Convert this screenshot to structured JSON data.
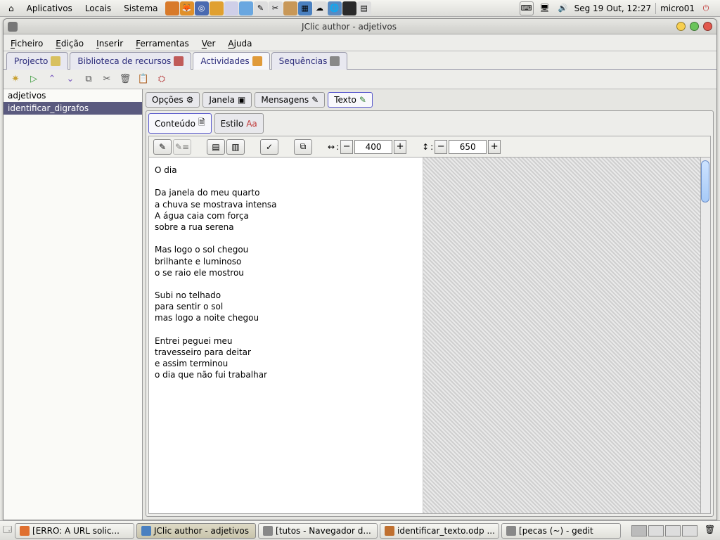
{
  "top_panel": {
    "home": "⌂",
    "menus": {
      "apps": "Aplicativos",
      "places": "Locais",
      "system": "Sistema"
    },
    "clock": "Seg 19 Out, 12:27",
    "user": "micro01"
  },
  "window": {
    "title": "JClic author - adjetivos",
    "menus": {
      "file": "Ficheiro",
      "edit": "Edição",
      "insert": "Inserir",
      "tools": "Ferramentas",
      "view": "Ver",
      "help": "Ajuda"
    },
    "tabs": {
      "project": "Projecto",
      "media": "Biblioteca de recursos",
      "activities": "Actividades",
      "sequences": "Sequências"
    }
  },
  "sidebar": {
    "items": [
      "adjetivos",
      "identificar_digrafos"
    ],
    "selected": 1
  },
  "subtabs": {
    "options": "Opções",
    "window": "Janela",
    "messages": "Mensagens",
    "text": "Texto"
  },
  "paneltabs": {
    "content": "Conteúdo",
    "style": "Estilo"
  },
  "dims": {
    "width": "400",
    "height": "650"
  },
  "document": {
    "title": "O dia",
    "stanzas": [
      [
        "Da janela do meu quarto",
        "a chuva se mostrava intensa",
        "A água caia com força",
        "sobre a rua serena"
      ],
      [
        "Mas logo o sol chegou",
        "brilhante e luminoso",
        "o se raio ele mostrou"
      ],
      [
        "Subi no telhado",
        "para sentir o sol",
        "mas logo a noite chegou"
      ],
      [
        "Entrei peguei meu",
        "travesseiro para deitar",
        "e assim terminou",
        "o dia que não fui trabalhar"
      ]
    ]
  },
  "taskbar": {
    "tasks": [
      {
        "label": "[ERRO: A URL solic...",
        "icon": "#e07030"
      },
      {
        "label": "JClic author - adjetivos",
        "icon": "#4a80c0",
        "active": true
      },
      {
        "label": "[tutos - Navegador d...",
        "icon": "#888"
      },
      {
        "label": "identificar_texto.odp ...",
        "icon": "#c07030"
      },
      {
        "label": "[pecas (~) - gedit",
        "icon": "#888"
      }
    ]
  }
}
